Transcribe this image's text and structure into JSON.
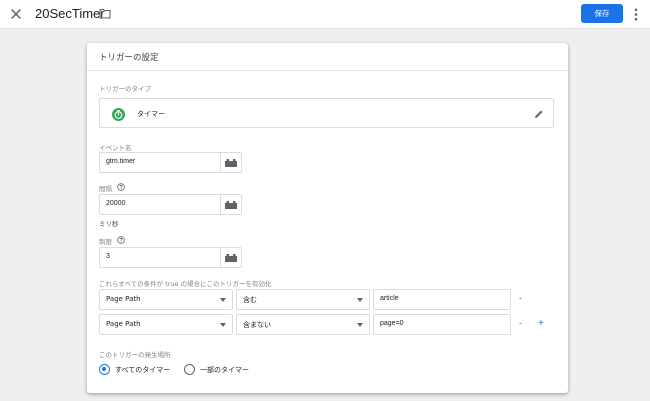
{
  "header": {
    "title": "20SecTimer",
    "save_label": "保存"
  },
  "card": {
    "title": "トリガーの設定",
    "trigger_type": {
      "label": "トリガーのタイプ",
      "name": "タイマー",
      "icon": "timer-icon"
    },
    "event_name": {
      "label": "イベント名",
      "value": "gtm.timer"
    },
    "interval": {
      "label": "間隔",
      "value": "20000",
      "unit": "ミリ秒"
    },
    "limit": {
      "label": "制限",
      "value": "3"
    },
    "conditions": {
      "label": "これらすべての条件が true の場合にこのトリガーを有効化",
      "rows": [
        {
          "variable": "Page Path",
          "operator": "含む",
          "value": "article",
          "remove": "-"
        },
        {
          "variable": "Page Path",
          "operator": "含まない",
          "value": "page=0",
          "remove": "-",
          "add": "+"
        }
      ]
    },
    "fires_on": {
      "label": "このトリガーの発生場所",
      "options": [
        {
          "label": "すべてのタイマー",
          "selected": true
        },
        {
          "label": "一部のタイマー",
          "selected": false
        }
      ]
    }
  },
  "colors": {
    "accent": "#1a73e8",
    "timer_green": "#34a853"
  }
}
